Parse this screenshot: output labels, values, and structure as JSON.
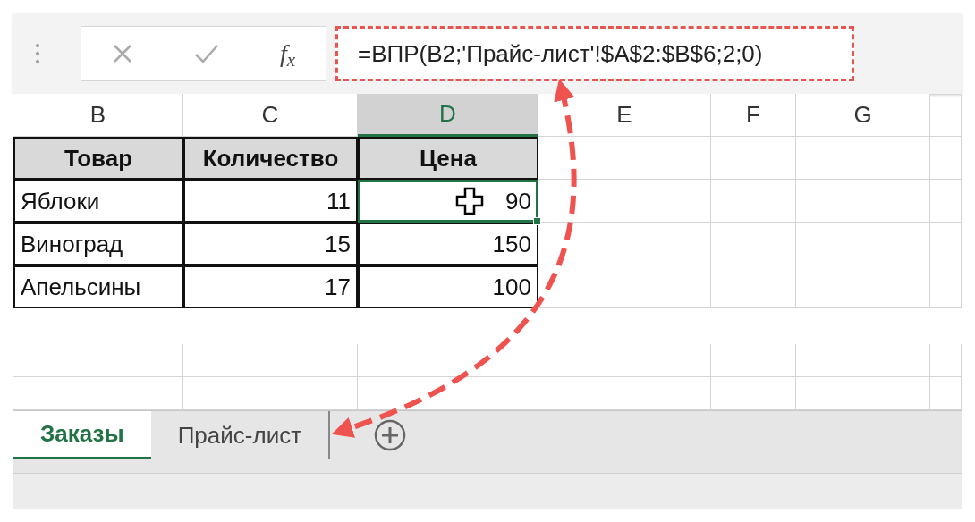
{
  "formula_bar": {
    "function_label": "f$_{x}$",
    "formula": "=ВПР(B2;'Прайс-лист'!$A$2:$B$6;2;0)",
    "highlighted": true
  },
  "columns": [
    {
      "label": "B",
      "selected": false
    },
    {
      "label": "C",
      "selected": false
    },
    {
      "label": "D",
      "selected": true
    },
    {
      "label": "E",
      "selected": false
    },
    {
      "label": "F",
      "selected": false
    },
    {
      "label": "G",
      "selected": false
    }
  ],
  "table": {
    "header": [
      "Товар",
      "Количество",
      "Цена"
    ],
    "rows": [
      {
        "cells": [
          {
            "text": "Яблоки",
            "selected": false
          },
          {
            "text": "11",
            "selected": false
          },
          {
            "text": "90",
            "selected": true
          }
        ]
      },
      {
        "cells": [
          {
            "text": "Виноград",
            "selected": false
          },
          {
            "text": "15",
            "selected": false
          },
          {
            "text": "150",
            "selected": false
          }
        ]
      },
      {
        "cells": [
          {
            "text": "Апельсины",
            "selected": false
          },
          {
            "text": "17",
            "selected": false
          },
          {
            "text": "100",
            "selected": false
          }
        ]
      }
    ]
  },
  "sheet_tabs": [
    {
      "label": "Заказы",
      "selected": true
    },
    {
      "label": "Прайс-лист",
      "selected": false
    }
  ]
}
